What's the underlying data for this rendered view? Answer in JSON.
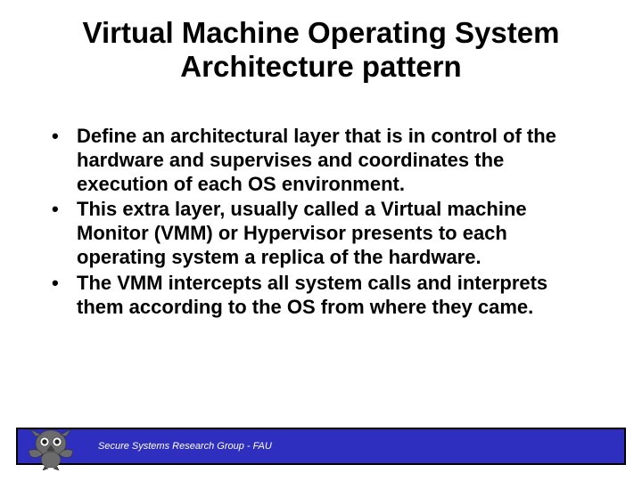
{
  "title": "Virtual Machine Operating System Architecture pattern",
  "bullets": [
    "Define an architectural layer that is in control of the hardware and supervises and coordinates the execution of each OS environment.",
    "This extra layer, usually called a Virtual machine Monitor (VMM) or Hypervisor presents to each operating system a replica of the hardware.",
    "The VMM intercepts all system calls and interprets them according to the OS from where they came."
  ],
  "footer": "Secure Systems Research Group - FAU"
}
